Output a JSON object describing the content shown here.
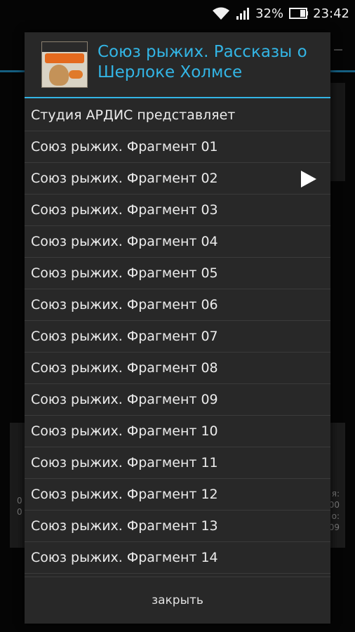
{
  "status": {
    "battery_percent": "32%",
    "time": "23:42",
    "icons": [
      "wifi-icon",
      "signal-icon",
      "battery-icon"
    ]
  },
  "background": {
    "left_edge": [
      "0",
      "0"
    ],
    "right_edge": [
      "я:",
      "00",
      "о:",
      "09"
    ]
  },
  "dialog": {
    "title": "Союз рыжих. Рассказы о Шерлоке Холмсе",
    "cover_icon": "book-cover",
    "items": [
      {
        "label": "Студия АРДИС представляет"
      },
      {
        "label": "Союз рыжих. Фрагмент 01"
      },
      {
        "label": "Союз рыжих. Фрагмент 02",
        "playing": true
      },
      {
        "label": "Союз рыжих. Фрагмент 03"
      },
      {
        "label": "Союз рыжих. Фрагмент 04"
      },
      {
        "label": "Союз рыжих. Фрагмент 05"
      },
      {
        "label": "Союз рыжих. Фрагмент 06"
      },
      {
        "label": "Союз рыжих. Фрагмент 07"
      },
      {
        "label": "Союз рыжих. Фрагмент 08"
      },
      {
        "label": "Союз рыжих. Фрагмент 09"
      },
      {
        "label": "Союз рыжих. Фрагмент 10"
      },
      {
        "label": "Союз рыжих. Фрагмент 11"
      },
      {
        "label": "Союз рыжих. Фрагмент 12"
      },
      {
        "label": "Союз рыжих. Фрагмент 13"
      },
      {
        "label": "Союз рыжих. Фрагмент 14"
      }
    ],
    "close_label": "закрыть"
  },
  "colors": {
    "accent": "#33b5e5",
    "dialog_bg": "#282828"
  }
}
